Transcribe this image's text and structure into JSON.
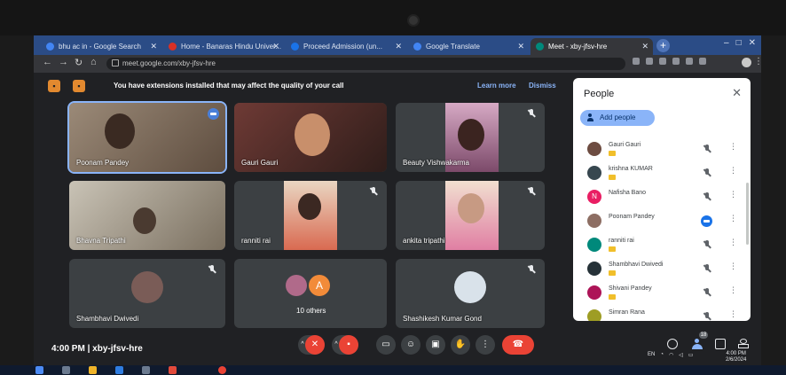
{
  "browser": {
    "tabs": [
      {
        "label": "bhu ac in - Google Search",
        "favicon_color": "#4285f4"
      },
      {
        "label": "Home - Banaras Hindu Univer...",
        "favicon_color": "#d93025"
      },
      {
        "label": "Proceed Admission (un...",
        "favicon_color": "#1a73e8"
      },
      {
        "label": "Google Translate",
        "favicon_color": "#4285f4"
      },
      {
        "label": "Meet - xby-jfsv-hre",
        "favicon_color": "#00897b"
      }
    ],
    "new_tab_label": "+",
    "url": "meet.google.com/xby-jfsv-hre",
    "window_controls": [
      "–",
      "□",
      "✕"
    ]
  },
  "banner": {
    "text": "You have extensions installed that may affect the quality of your call",
    "learn_more": "Learn more",
    "dismiss": "Dismiss"
  },
  "tiles": [
    {
      "name": "Poonam Pandey",
      "speaking": true
    },
    {
      "name": "Gauri Gauri",
      "speaking": false
    },
    {
      "name": "Beauty Vishwakarma",
      "speaking": false
    },
    {
      "name": "Bhavna Tripathi",
      "speaking": false
    },
    {
      "name": "ranniti rai",
      "speaking": false
    },
    {
      "name": "ankita tripathi",
      "speaking": false
    },
    {
      "name": "Shambhavi Dwivedi",
      "speaking": false
    },
    {
      "name": "10 others",
      "avatar_letter": "A"
    },
    {
      "name": "Shashikesh Kumar Gond",
      "speaking": false
    }
  ],
  "meeting": {
    "time": "4:00 PM",
    "separator": "|",
    "code": "xby-jfsv-hre",
    "people_count": "18"
  },
  "people_panel": {
    "title": "People",
    "add_label": "Add people",
    "participants": [
      {
        "name": "Gauri Gauri",
        "avatar_color": "#6d4c41",
        "speaking": false
      },
      {
        "name": "krishna KUMAR",
        "avatar_color": "#37474f",
        "speaking": false
      },
      {
        "name": "Nafisha Bano",
        "avatar_color": "#e91e63",
        "letter": "N",
        "speaking": false
      },
      {
        "name": "Poonam Pandey",
        "avatar_color": "#8d6e63",
        "speaking": true
      },
      {
        "name": "ranniti rai",
        "avatar_color": "#00897b",
        "speaking": false
      },
      {
        "name": "Shambhavi Dwivedi",
        "avatar_color": "#263238",
        "speaking": false
      },
      {
        "name": "Shivani Pandey",
        "avatar_color": "#ad1457",
        "speaking": false
      },
      {
        "name": "Simran Rana",
        "avatar_color": "#9e9d24",
        "speaking": false
      }
    ]
  },
  "tray": {
    "lang": "EN",
    "clock_time": "4:00 PM",
    "clock_date": "2/6/2024"
  },
  "colors": {
    "accent_blue": "#8ab4f8",
    "end_call_red": "#ea4335",
    "tile_bg": "#3c4043"
  }
}
